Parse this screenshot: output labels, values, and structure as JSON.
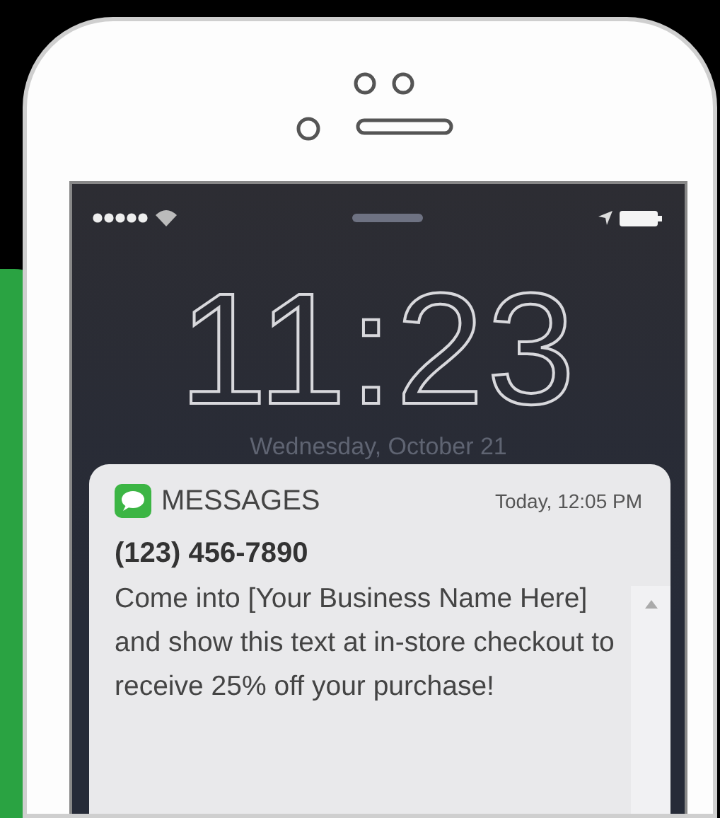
{
  "clock": "11:23",
  "date": "Wednesday, October 21",
  "notification": {
    "app": "MESSAGES",
    "time": "Today, 12:05 PM",
    "sender": "(123) 456-7890",
    "body": "Come into [Your Business Name Here] and show this text at in-store checkout to receive 25% off your purchase!"
  }
}
